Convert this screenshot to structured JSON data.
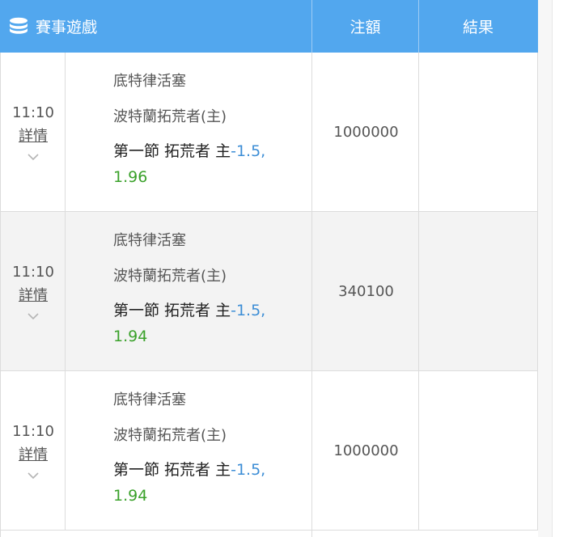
{
  "header": {
    "game_label": "賽事遊戲",
    "amount_label": "注額",
    "result_label": "結果"
  },
  "colors": {
    "header_bg": "#52a7ee",
    "handicap": "#3d8ed6",
    "odds": "#3aa12a",
    "alt_row": "#f3f3f3"
  },
  "rows": [
    {
      "time": "11:10",
      "detail": "詳情",
      "league": "底特律活塞",
      "team": "波特蘭拓荒者(主)",
      "bet": "第一節 拓荒者 主",
      "handicap": "-1.5,",
      "odds": "1.96",
      "amount": "1000000",
      "result": ""
    },
    {
      "time": "11:10",
      "detail": "詳情",
      "league": "底特律活塞",
      "team": "波特蘭拓荒者(主)",
      "bet": "第一節 拓荒者 主",
      "handicap": "-1.5,",
      "odds": "1.94",
      "amount": "340100",
      "result": ""
    },
    {
      "time": "11:10",
      "detail": "詳情",
      "league": "底特律活塞",
      "team": "波特蘭拓荒者(主)",
      "bet": "第一節 拓荒者 主",
      "handicap": "-1.5,",
      "odds": "1.94",
      "amount": "1000000",
      "result": ""
    }
  ]
}
